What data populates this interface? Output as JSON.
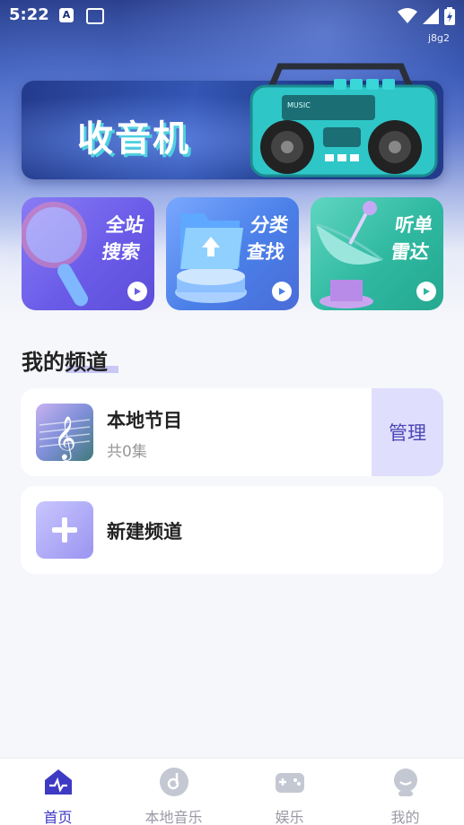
{
  "status_bar": {
    "time": "5:22",
    "tag": "j8g2"
  },
  "banner": {
    "title": "收音机",
    "device_label": "MUSIC"
  },
  "tiles": [
    {
      "label_line1": "全站",
      "label_line2": "搜索",
      "icon": "magnifier-icon"
    },
    {
      "label_line1": "分类",
      "label_line2": "查找",
      "icon": "folder-icon"
    },
    {
      "label_line1": "听单",
      "label_line2": "雷达",
      "icon": "radar-dish-icon"
    }
  ],
  "section": {
    "title": "我的频道"
  },
  "channels": [
    {
      "name": "本地节目",
      "count": "共0集",
      "action": "管理",
      "icon": "music-note-icon"
    },
    {
      "name": "新建频道",
      "icon": "plus-icon"
    }
  ],
  "tabbar": {
    "items": [
      {
        "label": "首页",
        "icon": "home-icon",
        "active": true
      },
      {
        "label": "本地音乐",
        "icon": "disc-icon",
        "active": false
      },
      {
        "label": "娱乐",
        "icon": "gamepad-icon",
        "active": false
      },
      {
        "label": "我的",
        "icon": "profile-icon",
        "active": false
      }
    ]
  },
  "colors": {
    "accent": "#3e3ac4",
    "manage_bg": "#e0defd",
    "tile1": "#6a5ce8",
    "tile2": "#4a7fe8",
    "tile3": "#2fb8a0"
  }
}
